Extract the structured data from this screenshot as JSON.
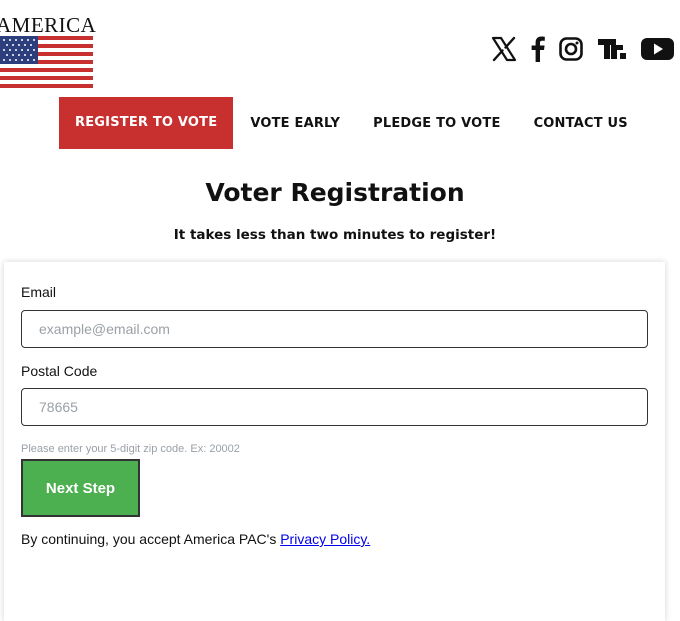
{
  "logo": {
    "text": "AMERICA",
    "flag_icon": "us-flag-icon"
  },
  "socials": [
    {
      "icon": "x-icon"
    },
    {
      "icon": "facebook-icon"
    },
    {
      "icon": "instagram-icon"
    },
    {
      "icon": "truth-social-icon"
    },
    {
      "icon": "youtube-icon"
    }
  ],
  "nav": {
    "items": [
      {
        "label": "REGISTER TO VOTE",
        "active": true
      },
      {
        "label": "VOTE EARLY"
      },
      {
        "label": "PLEDGE TO VOTE"
      },
      {
        "label": "CONTACT US"
      }
    ],
    "active_color": "#c8302f"
  },
  "page": {
    "title": "Voter Registration",
    "subtitle": "It takes less than two minutes to register!"
  },
  "form": {
    "email": {
      "label": "Email",
      "placeholder": "example@email.com",
      "value": ""
    },
    "postal": {
      "label": "Postal Code",
      "placeholder": "78665",
      "value": "",
      "hint": "Please enter your 5-digit zip code. Ex: 20002"
    },
    "next_button": {
      "label": "Next Step",
      "color": "#4caf50"
    },
    "consent": {
      "prefix": "By continuing, you accept America PAC's ",
      "link": "Privacy Policy."
    }
  }
}
